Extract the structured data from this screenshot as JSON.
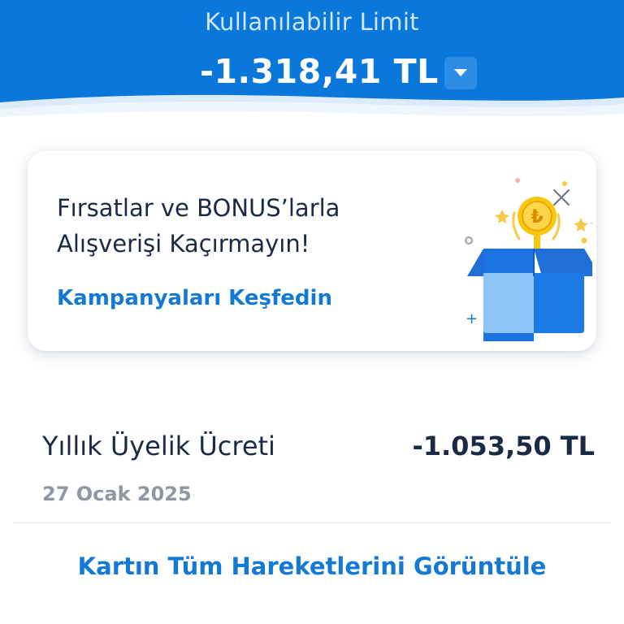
{
  "header": {
    "title": "Kullanılabilir Limit",
    "limit_amount": "-1.318,41 TL",
    "dropdown_icon": "chevron-down-icon"
  },
  "promo": {
    "title_line1": "Fırsatlar ve BONUS’larla",
    "title_line2": "Alışverişi Kaçırmayın!",
    "link": "Kampanyaları Keşfedin",
    "close_icon": "close-icon",
    "illustration": "gift-box-with-lira-coin-illustration",
    "coin_symbol": "₺"
  },
  "transactions": [
    {
      "name": "Yıllık Üyelik Ücreti",
      "amount": "-1.053,50 TL",
      "date": "27 Ocak 2025"
    }
  ],
  "footer": {
    "view_all": "Kartın Tüm Hareketlerini Görüntüle"
  },
  "colors": {
    "brand_blue": "#0A77DB",
    "link_blue": "#1479D3",
    "text_dark": "#1B2A44",
    "text_muted": "#8E97A3"
  }
}
